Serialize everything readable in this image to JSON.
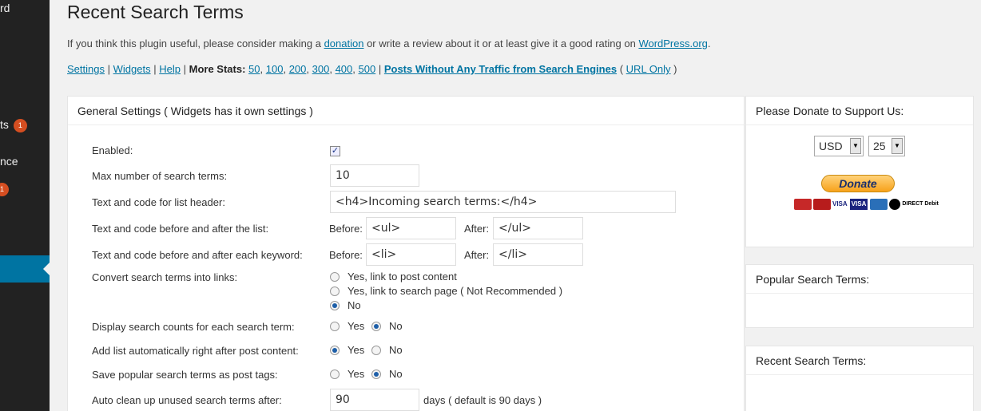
{
  "sidebar": {
    "items": [
      {
        "label": "rd"
      },
      {
        "label": "ts",
        "badge": "1"
      },
      {
        "label": "nce"
      },
      {
        "label": "",
        "badge": "1"
      }
    ]
  },
  "header": {
    "title": "Recent Search Terms",
    "intro": {
      "part1": "If you think this plugin useful, please consider making a ",
      "donation_link": "donation",
      "part2": " or write a review about it or at least give it a good rating on ",
      "wp_link": "WordPress.org",
      "part3": "."
    },
    "links": {
      "settings": "Settings",
      "widgets": "Widgets",
      "help": "Help",
      "more_stats_label": "More Stats:",
      "stats": [
        "50",
        "100",
        "200",
        "300",
        "400",
        "500"
      ],
      "no_traffic": "Posts Without Any Traffic from Search Engines",
      "url_only": "URL Only",
      "open_paren": "(",
      "close_paren": ")",
      "sep": "|"
    }
  },
  "general": {
    "title": "General Settings ( Widgets has it own settings )",
    "enabled_label": "Enabled:",
    "max_label": "Max number of search terms:",
    "max_value": "10",
    "header_label": "Text and code for list header:",
    "header_value": "<h4>Incoming search terms:</h4>",
    "list_label": "Text and code before and after the list:",
    "before_label": "Before:",
    "after_label": "After:",
    "list_before": "<ul>",
    "list_after": "</ul>",
    "kw_label": "Text and code before and after each keyword:",
    "kw_before": "<li>",
    "kw_after": "</li>",
    "convert_label": "Convert search terms into links:",
    "convert_options": [
      "Yes, link to post content",
      "Yes, link to search page ( Not Recommended )",
      "No"
    ],
    "counts_label": "Display search counts for each search term:",
    "auto_label": "Add list automatically right after post content:",
    "tags_label": "Save popular search terms as post tags:",
    "yes": "Yes",
    "no": "No",
    "cleanup_label": "Auto clean up unused search terms after:",
    "cleanup_value": "90",
    "cleanup_suffix": "days ( default is 90 days )"
  },
  "donate": {
    "title": "Please Donate to Support Us:",
    "currency": "USD",
    "amount": "25",
    "button": "Donate",
    "cards": [
      "VISA",
      "VISA"
    ],
    "direct_debit": "DIRECT Debit"
  },
  "popular": {
    "title": "Popular Search Terms:"
  },
  "recent": {
    "title": "Recent Search Terms:"
  }
}
